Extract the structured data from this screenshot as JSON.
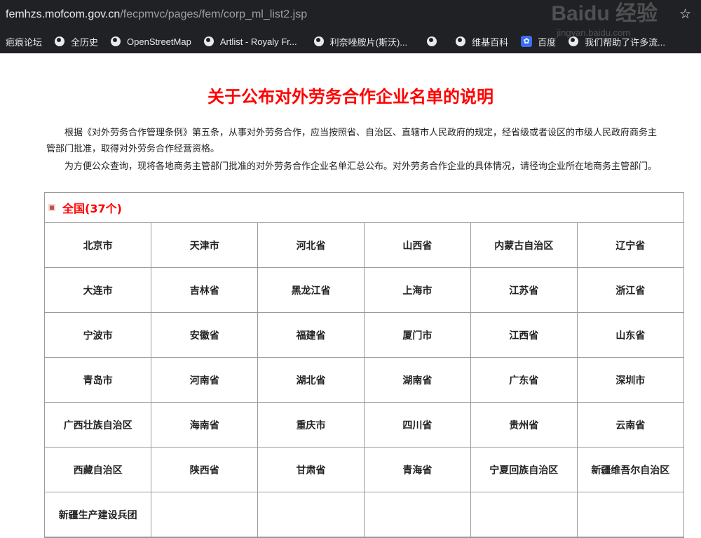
{
  "browser": {
    "url_host": "femhzs.mofcom.gov.cn",
    "url_path": "/fecpmvc/pages/fem/corp_ml_list2.jsp",
    "bookmarks": [
      {
        "label": "疤痕论坛",
        "icon": ""
      },
      {
        "label": "全历史",
        "icon": "globe-icon"
      },
      {
        "label": "OpenStreetMap",
        "icon": "globe-icon"
      },
      {
        "label": "Artlist - Royaly Fr...",
        "icon": "globe-icon"
      },
      {
        "label": "利奈唑胺片(斯沃)...",
        "icon": "globe-icon"
      },
      {
        "label": "",
        "icon": "globe-icon"
      },
      {
        "label": "维基百科",
        "icon": "globe-icon"
      },
      {
        "label": "百度",
        "icon": "paw-icon"
      },
      {
        "label": "我们帮助了许多流...",
        "icon": "globe-icon"
      }
    ]
  },
  "page": {
    "title": "关于公布对外劳务合作企业名单的说明",
    "paragraph1": "根据《对外劳务合作管理条例》第五条，从事对外劳务合作，应当按照省、自治区、直辖市人民政府的规定，经省级或者设区的市级人民政府商务主管部门批准，取得对外劳务合作经营资格。",
    "paragraph2": "为方便公众查询，现将各地商务主管部门批准的对外劳务合作企业名单汇总公布。对外劳务合作企业的具体情况，请径询企业所在地商务主管部门。",
    "section_heading": "全国(37个)",
    "regions": [
      [
        "北京市",
        "天津市",
        "河北省",
        "山西省",
        "内蒙古自治区",
        "辽宁省"
      ],
      [
        "大连市",
        "吉林省",
        "黑龙江省",
        "上海市",
        "江苏省",
        "浙江省"
      ],
      [
        "宁波市",
        "安徽省",
        "福建省",
        "厦门市",
        "江西省",
        "山东省"
      ],
      [
        "青岛市",
        "河南省",
        "湖北省",
        "湖南省",
        "广东省",
        "深圳市"
      ],
      [
        "广西壮族自治区",
        "海南省",
        "重庆市",
        "四川省",
        "贵州省",
        "云南省"
      ],
      [
        "西藏自治区",
        "陕西省",
        "甘肃省",
        "青海省",
        "宁夏回族自治区",
        "新疆维吾尔自治区"
      ],
      [
        "新疆生产建设兵团",
        "",
        "",
        "",
        "",
        ""
      ]
    ]
  },
  "watermark": {
    "line1": "Baidu 经验",
    "line2": "jingyan.baidu.com"
  }
}
